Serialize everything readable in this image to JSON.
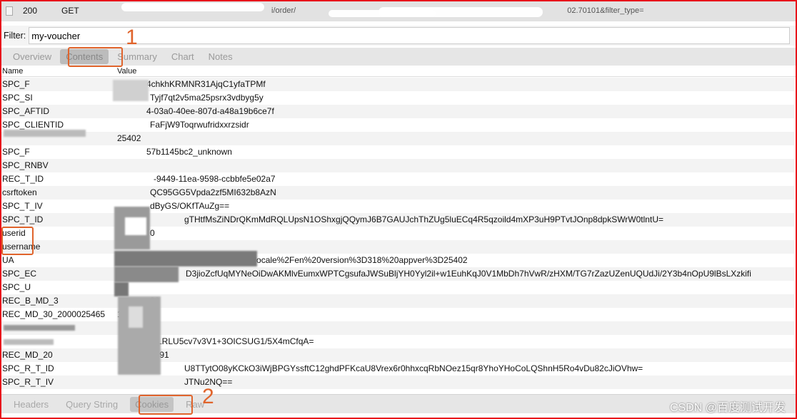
{
  "request": {
    "status": "200",
    "method": "GET",
    "url_fragment": "i/order/",
    "url_tail": "02.70101&filter_type="
  },
  "filter": {
    "label": "Filter:",
    "value": "my-voucher"
  },
  "tabs": [
    "Overview",
    "Contents",
    "Summary",
    "Chart",
    "Notes"
  ],
  "active_tab": "Contents",
  "columns": {
    "name": "Name",
    "value": "Value"
  },
  "rows": [
    {
      "name": "SPC_F",
      "value": "4chkhKRMNR31AjqC1yfaTPMf"
    },
    {
      "name": "SPC_SI",
      "value": "Tyjf7qt2v5ma25psrx3vdbyg5y"
    },
    {
      "name": "SPC_AFTID",
      "value": "4-03a0-40ee-807d-a48a19b6ce7f"
    },
    {
      "name": "SPC_CLIENTID",
      "value": "FaFjW9Toqrwufridxxrzsidr"
    },
    {
      "name": "",
      "value": "25402"
    },
    {
      "name": "SPC_F",
      "value": "57b1145bc2_unknown"
    },
    {
      "name": "SPC_RNBV",
      "value": ""
    },
    {
      "name": "REC_T_ID",
      "value": "-9449-11ea-9598-ccbbfe5e02a7"
    },
    {
      "name": "csrftoken",
      "value": "QC95GG5Vpda2zf5MI632b8AzN"
    },
    {
      "name": "SPC_T_IV",
      "value": "dByGS/OKfTAuZg=="
    },
    {
      "name": "SPC_T_ID",
      "value": "gTHtfMsZiNDrQKmMdRQLUpsN1OShxgjQQymJ6B7GAUJchThZUg5luECq4R5qzoild4mXP3uH9PTvtJOnp8dpkSWrW0tlntU="
    },
    {
      "name": "userid",
      "value": "0"
    },
    {
      "name": "username",
      "value": ""
    },
    {
      "name": "UA",
      "value": "20locale%2Fen%20version%3D318%20appver%3D25402"
    },
    {
      "name": "SPC_EC",
      "value": "D3jioZcfUqMYNeOiDwAKMlvEumxWPTCgsufaJWSuBljYH0Yyl2il+w1EuhKqJ0V1MbDh7hVwR/zHXM/TG7rZazUZenUQUdJi/2Y3b4nOpU9lBsLXzkifi"
    },
    {
      "name": "SPC_U",
      "value": ""
    },
    {
      "name": "REC_B_MD_3",
      "value": "28"
    },
    {
      "name": "REC_MD_30_2000025465",
      "value": "1"
    },
    {
      "name": "",
      "value": ""
    },
    {
      "name": "",
      "value": "/eLRLU5cv7v3V1+3OICSUG1/5X4mCfqA="
    },
    {
      "name": "REC_MD_20",
      "value": "6591"
    },
    {
      "name": "SPC_R_T_ID",
      "value": "U8TTytO08yKCkO3iWjBPGYssftC12ghdPFKcaU8Vrex6r0hhxcqRbNOez15qr8YhoYHoCoLQShnH5Ro4vDu82cJiOVhw="
    },
    {
      "name": "SPC_R_T_IV",
      "value": "JTNu2NQ=="
    }
  ],
  "bottom_tabs": [
    "Headers",
    "Query String",
    "Cookies",
    "Raw"
  ],
  "active_bottom_tab": "Cookies",
  "annotations": [
    "1",
    "2"
  ],
  "watermark": "CSDN @百度测试开发",
  "colors": {
    "annotation": "#e0642c",
    "frame": "#e8141b"
  }
}
